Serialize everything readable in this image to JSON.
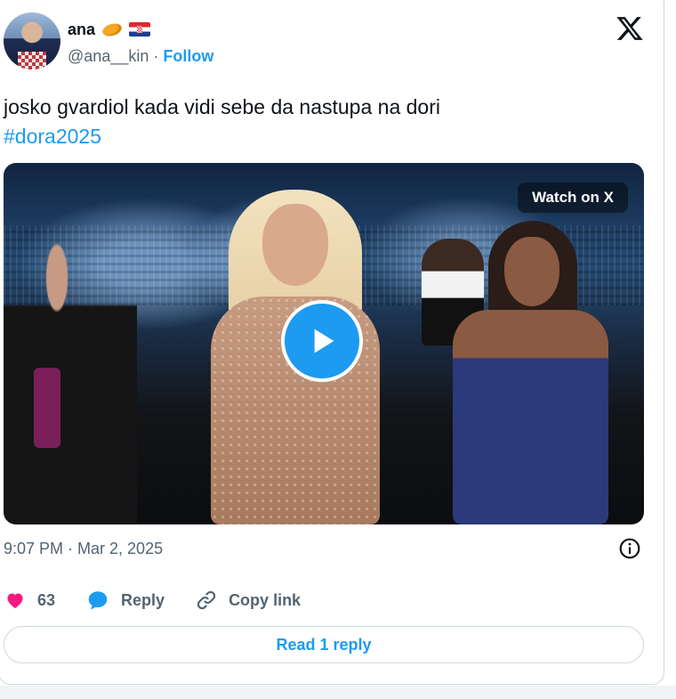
{
  "author": {
    "display_name": "ana",
    "handle": "@ana__kin",
    "separator": "·",
    "follow_label": "Follow"
  },
  "tweet": {
    "text": "josko gvardiol kada vidi sebe da nastupa na dori",
    "hashtag": "#dora2025"
  },
  "media": {
    "watch_label": "Watch on X"
  },
  "meta": {
    "timestamp": "9:07 PM · Mar 2, 2025"
  },
  "actions": {
    "like_count": "63",
    "reply_label": "Reply",
    "copy_link_label": "Copy link"
  },
  "footer": {
    "read_replies_label": "Read 1 reply"
  },
  "colors": {
    "accent": "#1d9bf0",
    "like": "#f91880",
    "secondary_text": "#536471"
  }
}
